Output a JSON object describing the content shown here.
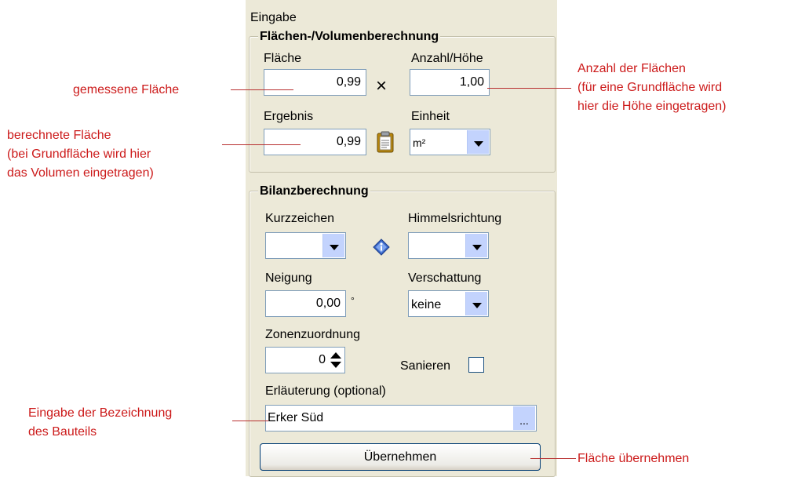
{
  "panel": {
    "title": "Eingabe"
  },
  "area_group": {
    "legend": "Flächen-/Volumenberechnung",
    "flaeche_label": "Fläche",
    "flaeche_value": "0,99",
    "multiply_symbol": "×",
    "anzahl_label": "Anzahl/Höhe",
    "anzahl_value": "1,00",
    "ergebnis_label": "Ergebnis",
    "ergebnis_value": "0,99",
    "einheit_label": "Einheit",
    "einheit_value": "m²"
  },
  "balance_group": {
    "legend": "Bilanzberechnung",
    "kurzzeichen_label": "Kurzzeichen",
    "kurzzeichen_value": "",
    "himmelsrichtung_label": "Himmelsrichtung",
    "himmelsrichtung_value": "",
    "neigung_label": "Neigung",
    "neigung_value": "0,00",
    "neigung_unit": "°",
    "verschattung_label": "Verschattung",
    "verschattung_value": "keine",
    "zonen_label": "Zonenzuordnung",
    "zonen_value": "0",
    "sanieren_label": "Sanieren",
    "sanieren_checked": false,
    "erlaeuterung_label": "Erläuterung (optional)",
    "erlaeuterung_value": "Erker Süd",
    "ellipsis_label": "...",
    "submit_label": "Übernehmen"
  },
  "annotations": {
    "gemessene": "gemessene Fläche",
    "berechnete_1": "berechnete Fläche",
    "berechnete_2": "(bei Grundfläche wird hier",
    "berechnete_3": "das Volumen eingetragen)",
    "anzahl_1": "Anzahl der Flächen",
    "anzahl_2": "(für eine Grundfläche wird",
    "anzahl_3": "hier die Höhe eingetragen)",
    "eingabe_1": "Eingabe der Bezeichnung",
    "eingabe_2": "des Bauteils",
    "uebernehmen": "Fläche übernehmen"
  },
  "colors": {
    "annotation": "#cc1a1a",
    "panel_bg": "#ece9d8",
    "input_border": "#7f9db9",
    "dropdown_button": "#c3d3fd"
  },
  "icons": {
    "clipboard": "clipboard-icon",
    "info": "info-diamond-icon",
    "spinner": "spinner-arrows-icon"
  }
}
